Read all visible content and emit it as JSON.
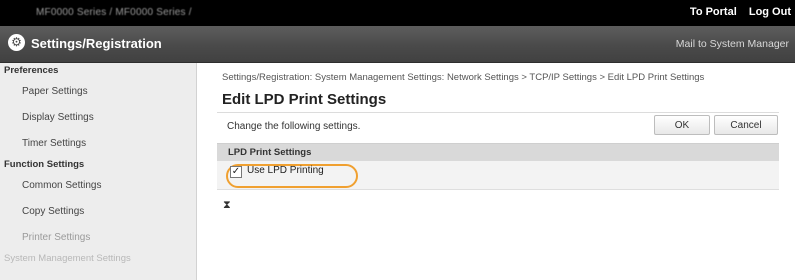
{
  "topbar": {
    "model": "MF0000 Series / MF0000 Series /",
    "portal_link": "To Portal",
    "logout_link": "Log Out"
  },
  "header": {
    "icon_glyph": "⚙",
    "title": "Settings/Registration",
    "mail_link": "Mail to System Manager"
  },
  "sidebar": {
    "group_preferences": "Preferences",
    "paper": "Paper Settings",
    "display": "Display Settings",
    "timer": "Timer Settings",
    "group_function": "Function Settings",
    "common": "Common Settings",
    "copy": "Copy Settings",
    "printer": "Printer Settings",
    "group_system": "System Management Settings"
  },
  "main": {
    "breadcrumb": "Settings/Registration: System Management Settings: Network Settings > TCP/IP Settings > Edit LPD Print Settings",
    "title": "Edit LPD Print Settings",
    "instruction": "Change the following settings.",
    "ok_label": "OK",
    "cancel_label": "Cancel",
    "section_title": "LPD Print Settings",
    "checkbox_label": "Use LPD Printing",
    "checkbox_checked": true,
    "top_marker": "⧗"
  },
  "colors": {
    "highlight": "#f0a030",
    "header_bg": "#4a4a4a",
    "topbar_bg": "#000000"
  }
}
